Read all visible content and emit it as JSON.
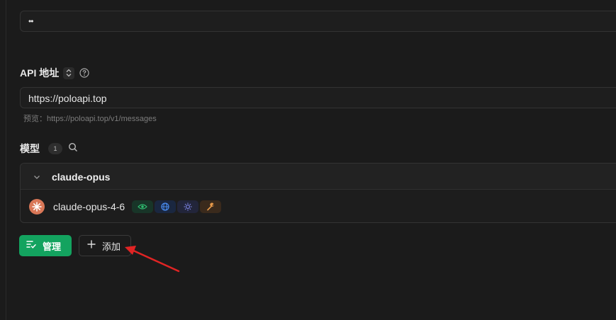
{
  "password_field": {
    "value": "••"
  },
  "api_address": {
    "label": "API 地址",
    "value": "https://poloapi.top",
    "preview": "预览：https://poloapi.top/v1/messages"
  },
  "models": {
    "label": "模型",
    "count": "1",
    "group": {
      "name": "claude-opus",
      "items": [
        {
          "name": "claude-opus-4-6",
          "tags": [
            "eye-icon",
            "globe-icon",
            "sun-icon",
            "wrench-icon"
          ]
        }
      ]
    }
  },
  "buttons": {
    "manage": "管理",
    "add": "添加"
  },
  "colors": {
    "accent": "#13a35f",
    "annotation_arrow": "#e02424",
    "avatar": "#d97757"
  }
}
